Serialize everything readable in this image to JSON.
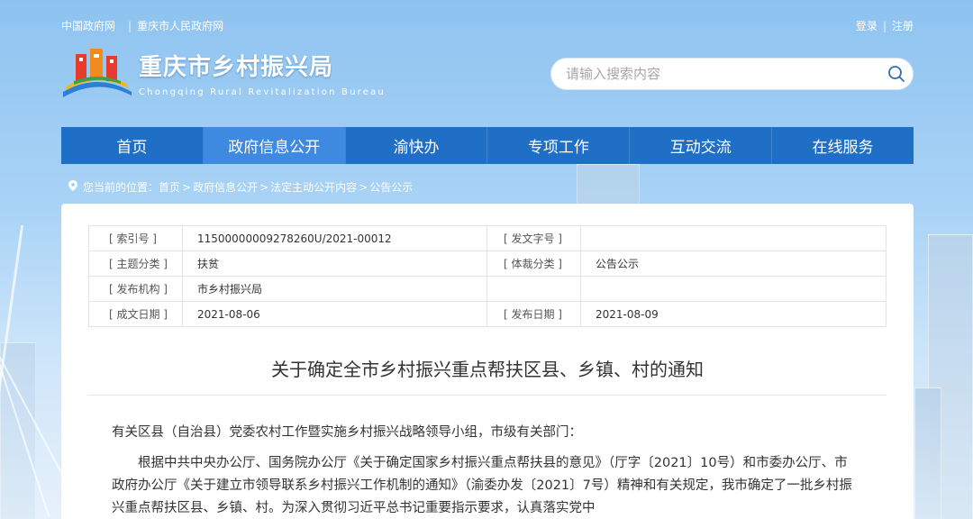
{
  "top_links": {
    "gov": "中国政府网",
    "cq": "重庆市人民政府网",
    "sep": "|"
  },
  "auth": {
    "login": "登录",
    "register": "注册",
    "sep": "|"
  },
  "site": {
    "title_cn": "重庆市乡村振兴局",
    "title_en": "Chongqing Rural Revitalization Bureau"
  },
  "search": {
    "placeholder": "请输入搜索内容"
  },
  "nav": {
    "items": [
      "首页",
      "政府信息公开",
      "渝快办",
      "专项工作",
      "互动交流",
      "在线服务"
    ],
    "active_index": 1
  },
  "breadcrumb": {
    "prefix": "您当前的位置：",
    "items": [
      "首页",
      "政府信息公开",
      "法定主动公开内容",
      "公告公示"
    ],
    "sep": ">"
  },
  "meta": {
    "index_label": "[ 索引号 ]",
    "index_value": "11500000009278260U/2021-00012",
    "docno_label": "[ 发文字号 ]",
    "docno_value": "",
    "topic_label": "[ 主题分类 ]",
    "topic_value": "扶贫",
    "genre_label": "[ 体裁分类 ]",
    "genre_value": "公告公示",
    "org_label": "[ 发布机构 ]",
    "org_value": "市乡村振兴局",
    "created_label": "[ 成文日期 ]",
    "created_value": "2021-08-06",
    "published_label": "[ 发布日期 ]",
    "published_value": "2021-08-09"
  },
  "doc": {
    "title": "关于确定全市乡村振兴重点帮扶区县、乡镇、村的通知",
    "salutation": "有关区县（自治县）党委农村工作暨实施乡村振兴战略领导小组，市级有关部门：",
    "para1": "根据中共中央办公厅、国务院办公厅《关于确定国家乡村振兴重点帮扶县的意见》（厅字〔2021〕10号）和市委办公厅、市政府办公厅《关于建立市领导联系乡村振兴工作机制的通知》（渝委办发〔2021〕7号）精神和有关规定，我市确定了一批乡村振兴重点帮扶区县、乡镇、村。为深入贯彻习近平总书记重要指示要求，认真落实党中"
  },
  "colors": {
    "nav_bg": "#1f6fc7",
    "nav_active": "#3d8ae0"
  }
}
